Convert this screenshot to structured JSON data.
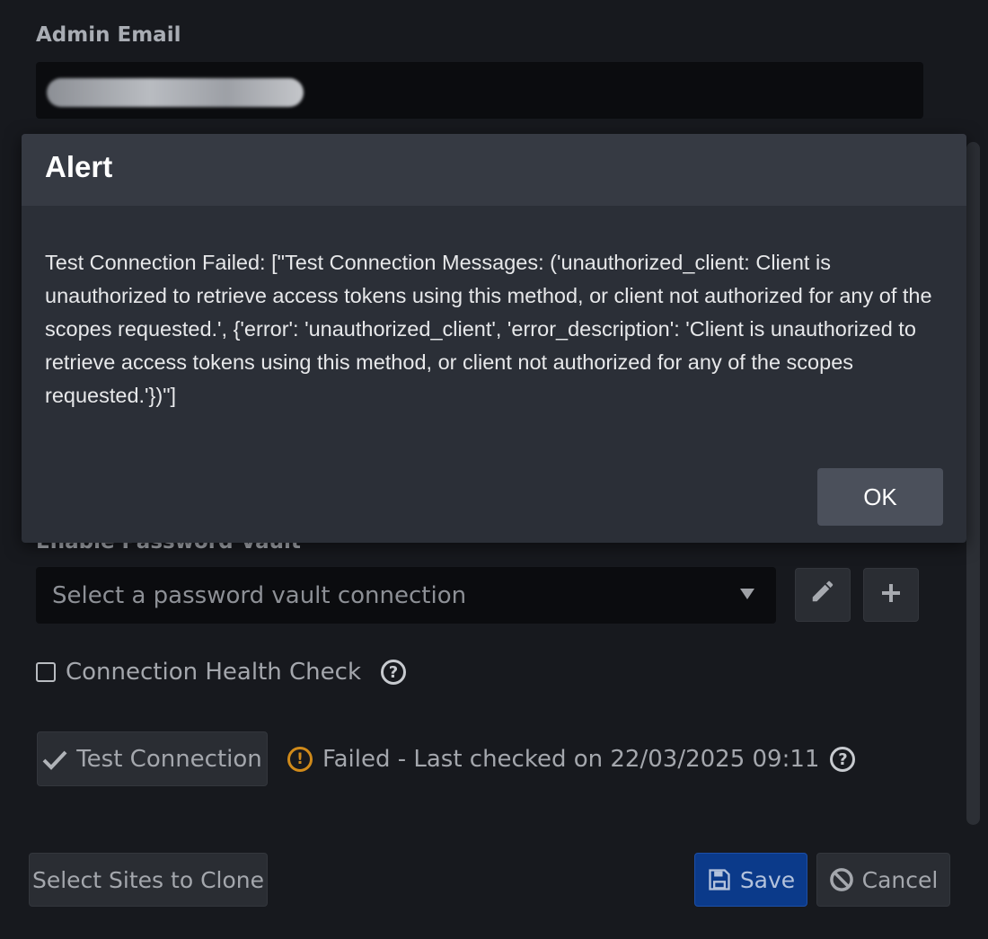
{
  "form": {
    "admin_email_label": "Admin Email",
    "vault_label": "Enable Password Vault",
    "vault_select_placeholder": "Select a password vault connection",
    "health_check_label": "Connection Health Check",
    "health_check_checked": false,
    "test_connection_label": "Test Connection",
    "status_text": "Failed - Last checked on 22/03/2025 09:11"
  },
  "footer": {
    "clone_label": "Select Sites to Clone",
    "save_label": "Save",
    "cancel_label": "Cancel"
  },
  "alert": {
    "title": "Alert",
    "message": "Test Connection Failed: [\"Test Connection Messages: ('unauthorized_client: Client is unauthorized to retrieve access tokens using this method, or client not authorized for any of the scopes requested.', {'error': 'unauthorized_client', 'error_description': 'Client is unauthorized to retrieve access tokens using this method, or client not authorized for any of the scopes requested.'})\"]",
    "ok_label": "OK"
  },
  "colors": {
    "background": "#17191e",
    "modal": "#2b2f37",
    "primary": "#0b3a8a",
    "warning": "#d08a1a"
  },
  "icons": [
    "pencil-icon",
    "plus-icon",
    "help-icon",
    "check-icon",
    "warning-icon",
    "floppy-disk-icon",
    "ban-icon",
    "caret-down-icon"
  ]
}
